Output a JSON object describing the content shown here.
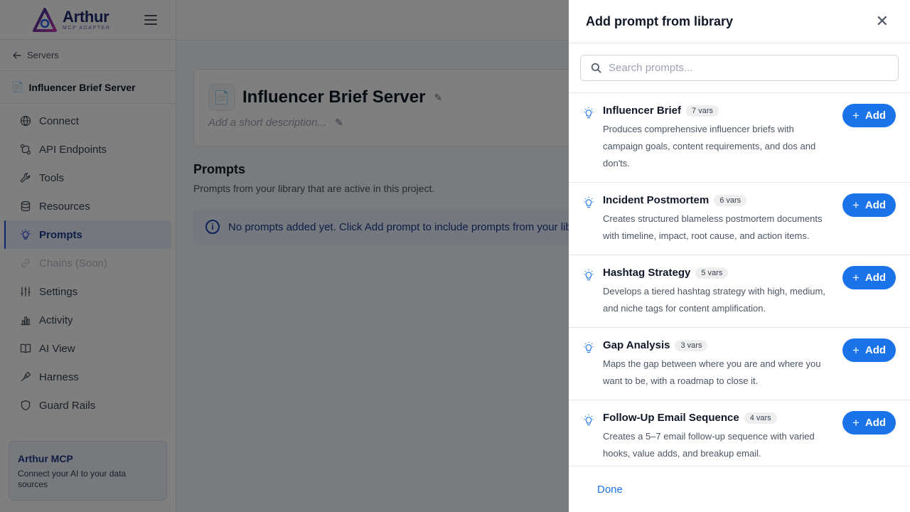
{
  "sidebar": {
    "logo": {
      "name": "Arthur",
      "subtitle": "MCP ADAPTER"
    },
    "back_label": "Servers",
    "server_name": "Influencer Brief Server",
    "items": [
      {
        "label": "Connect",
        "icon": "globe-icon"
      },
      {
        "label": "API Endpoints",
        "icon": "api-icon"
      },
      {
        "label": "Tools",
        "icon": "wrench-icon"
      },
      {
        "label": "Resources",
        "icon": "database-icon"
      },
      {
        "label": "Prompts",
        "icon": "lightbulb-icon",
        "active": true
      },
      {
        "label": "Chains (Soon)",
        "icon": "link-icon",
        "disabled": true
      },
      {
        "label": "Settings",
        "icon": "sliders-icon"
      },
      {
        "label": "Activity",
        "icon": "bar-chart-icon"
      },
      {
        "label": "AI View",
        "icon": "book-icon"
      },
      {
        "label": "Harness",
        "icon": "harness-icon"
      },
      {
        "label": "Guard Rails",
        "icon": "shield-icon"
      }
    ],
    "promo": {
      "title": "Arthur MCP",
      "text": "Connect your AI to your data sources"
    }
  },
  "main": {
    "server_title": "Influencer Brief Server",
    "description_placeholder": "Add a short description...",
    "prompts_title": "Prompts",
    "prompts_subtitle": "Prompts from your library that are active in this project.",
    "empty_message": "No prompts added yet. Click Add prompt to include prompts from your library."
  },
  "drawer": {
    "title": "Add prompt from library",
    "search_placeholder": "Search prompts...",
    "add_label": "Add",
    "done_label": "Done",
    "prompts": [
      {
        "name": "Influencer Brief",
        "vars": "7 vars",
        "description": "Produces comprehensive influencer briefs with campaign goals, content requirements, and dos and don'ts."
      },
      {
        "name": "Incident Postmortem",
        "vars": "6 vars",
        "description": "Creates structured blameless postmortem documents with timeline, impact, root cause, and action items."
      },
      {
        "name": "Hashtag Strategy",
        "vars": "5 vars",
        "description": "Develops a tiered hashtag strategy with high, medium, and niche tags for content amplification."
      },
      {
        "name": "Gap Analysis",
        "vars": "3 vars",
        "description": "Maps the gap between where you are and where you want to be, with a roadmap to close it."
      },
      {
        "name": "Follow-Up Email Sequence",
        "vars": "4 vars",
        "description": "Creates a 5–7 email follow-up sequence with varied hooks, value adds, and breakup email."
      }
    ]
  },
  "colors": {
    "accent": "#1a73e8",
    "brand": "#1e2a6e",
    "active_nav_bg": "#e8eefc"
  }
}
